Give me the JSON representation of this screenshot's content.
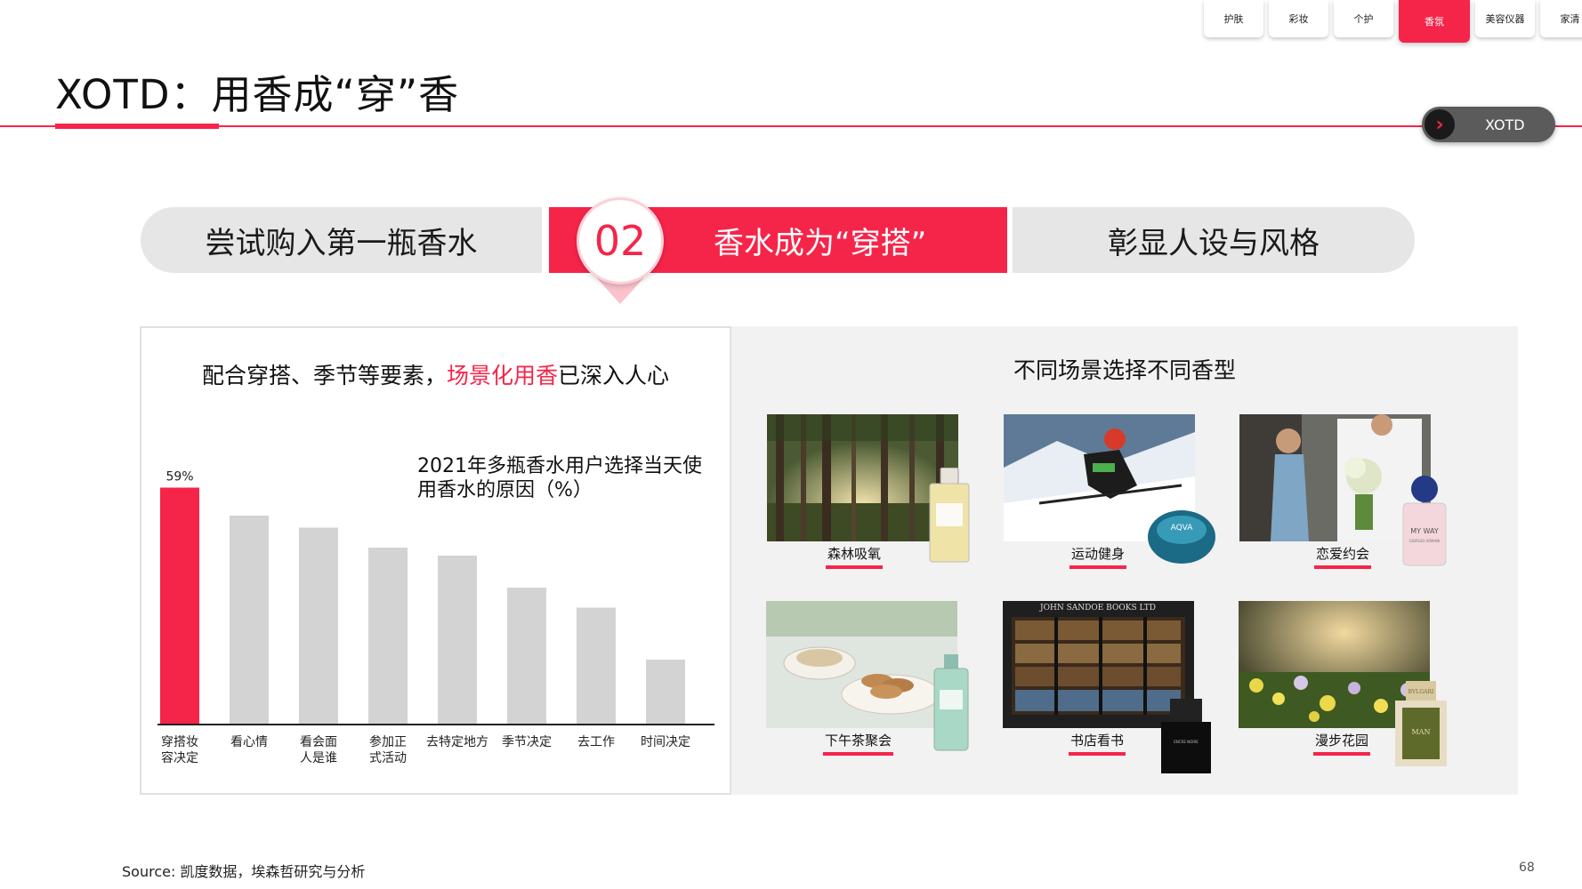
{
  "tabs": [
    "护肤",
    "彩妆",
    "个护",
    "香氛",
    "美容仪器",
    "家清"
  ],
  "active_tab_index": 3,
  "title": "XOTD：用香成“穿”香",
  "badge": "XOTD",
  "steps": {
    "left": "尝试购入第一瓶香水",
    "number": "02",
    "middle": "香水成为“穿搭”",
    "right": "彰显人设与风格"
  },
  "left_panel": {
    "title_part1": "配合穿搭、季节等要素，",
    "title_highlight": "场景化用香",
    "title_part2": "已深入人心"
  },
  "chart_data": {
    "type": "bar",
    "title": "2021年多瓶香水用户选择当天使用香水的原因（%）",
    "categories": [
      "穿搭妆\n容决定",
      "看心情",
      "看会面\n人是谁",
      "参加正\n式活动",
      "去特定地方",
      "季节决定",
      "去工作",
      "时间决定"
    ],
    "values": [
      59,
      52,
      49,
      44,
      42,
      34,
      29,
      16
    ],
    "data_labels": [
      "59%"
    ],
    "highlight_color": "#f5254a",
    "bar_color": "#d3d3d3",
    "ylim": [
      0,
      60
    ]
  },
  "right_panel": {
    "title": "不同场景选择不同香型",
    "scenes": [
      {
        "label": "森林吸氧",
        "scene": "forest",
        "bottle": "jo-malone-bottle"
      },
      {
        "label": "运动健身",
        "scene": "ski",
        "bottle": "aqva-bottle"
      },
      {
        "label": "恋爱约会",
        "scene": "date",
        "bottle": "my-way-bottle"
      },
      {
        "label": "下午茶聚会",
        "scene": "tea",
        "bottle": "hermes-bottle"
      },
      {
        "label": "书店看书",
        "scene": "bookstore",
        "bottle": "encre-noire-bottle"
      },
      {
        "label": "漫步花园",
        "scene": "garden",
        "bottle": "bvlgari-man-bottle"
      }
    ],
    "bottle_texts": {
      "aqva": "AQVA",
      "myway": "MY WAY",
      "myway_sub": "GIORGIO ARMANI",
      "bookstore_sign": "JOHN SANDOE BOOKS LTD",
      "encre": "ENCRE NOIRE",
      "man": "MAN",
      "bvlgari": "BVLGARI"
    }
  },
  "source": "Source: 凯度数据，埃森哲研究与分析",
  "page_number": "68"
}
